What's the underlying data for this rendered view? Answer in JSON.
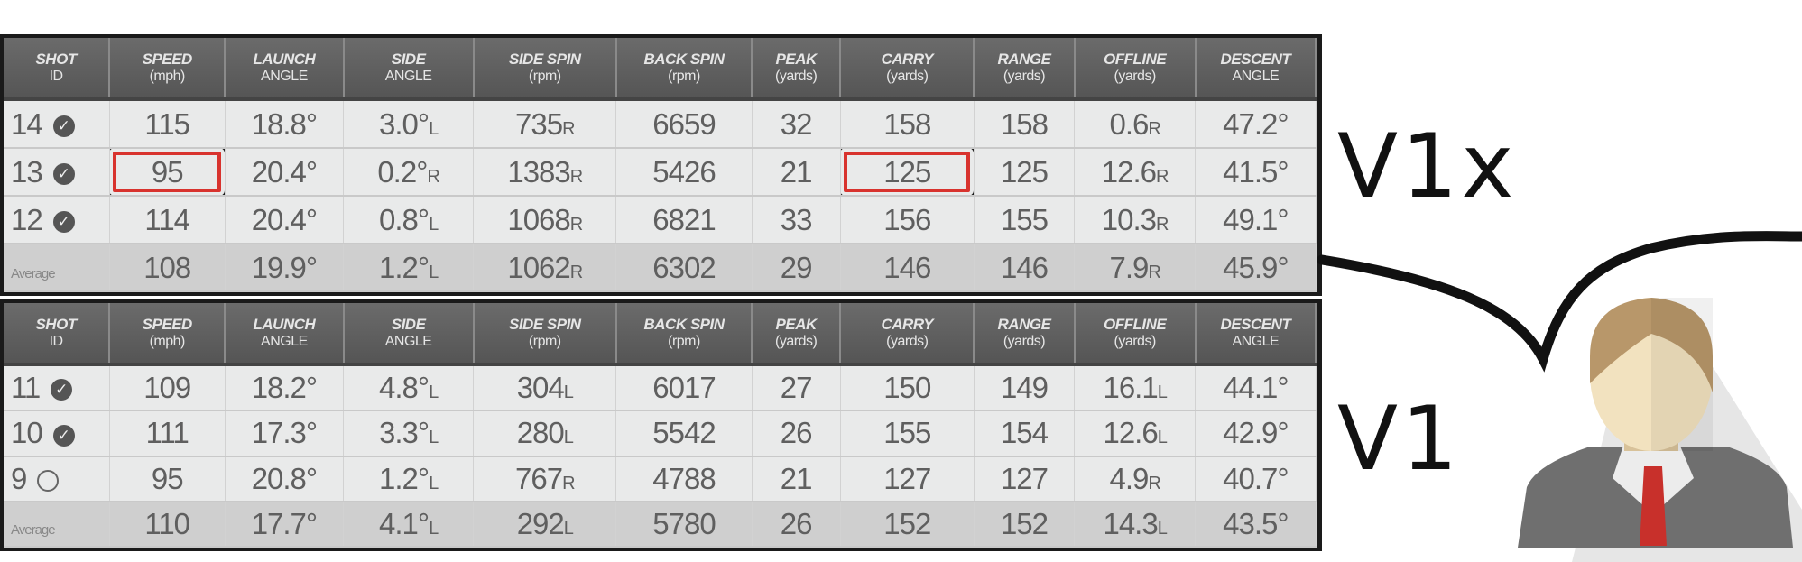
{
  "columns": [
    {
      "name": "SHOT",
      "unit": "ID"
    },
    {
      "name": "SPEED",
      "unit": "(mph)"
    },
    {
      "name": "LAUNCH",
      "unit": "ANGLE"
    },
    {
      "name": "SIDE",
      "unit": "ANGLE"
    },
    {
      "name": "SIDE SPIN",
      "unit": "(rpm)"
    },
    {
      "name": "BACK SPIN",
      "unit": "(rpm)"
    },
    {
      "name": "PEAK",
      "unit": "(yards)"
    },
    {
      "name": "CARRY",
      "unit": "(yards)"
    },
    {
      "name": "RANGE",
      "unit": "(yards)"
    },
    {
      "name": "OFFLINE",
      "unit": "(yards)"
    },
    {
      "name": "DESCENT",
      "unit": "ANGLE"
    }
  ],
  "tables": [
    {
      "label": "V1x",
      "rows": [
        {
          "id": "14",
          "checked": true,
          "cells": [
            "115",
            "18.8°",
            "3.0°|L",
            "735|R",
            "6659",
            "32",
            "158",
            "158",
            "0.6|R",
            "47.2°"
          ]
        },
        {
          "id": "13",
          "checked": true,
          "cells": [
            "95",
            "20.4°",
            "0.2°|R",
            "1383|R",
            "5426",
            "21",
            "125",
            "125",
            "12.6|R",
            "41.5°"
          ],
          "highlight": [
            0,
            6
          ]
        },
        {
          "id": "12",
          "checked": true,
          "cells": [
            "114",
            "20.4°",
            "0.8°|L",
            "1068|R",
            "6821",
            "33",
            "156",
            "155",
            "10.3|R",
            "49.1°"
          ]
        },
        {
          "id": "Average",
          "average": true,
          "cells": [
            "108",
            "19.9°",
            "1.2°|L",
            "1062|R",
            "6302",
            "29",
            "146",
            "146",
            "7.9|R",
            "45.9°"
          ]
        }
      ]
    },
    {
      "label": "V1",
      "rows": [
        {
          "id": "11",
          "checked": true,
          "cells": [
            "109",
            "18.2°",
            "4.8°|L",
            "304|L",
            "6017",
            "27",
            "150",
            "149",
            "16.1|L",
            "44.1°"
          ]
        },
        {
          "id": "10",
          "checked": true,
          "cells": [
            "111",
            "17.3°",
            "3.3°|L",
            "280|L",
            "5542",
            "26",
            "155",
            "154",
            "12.6|L",
            "42.9°"
          ]
        },
        {
          "id": "9",
          "checked": false,
          "cells": [
            "95",
            "20.8°",
            "1.2°|L",
            "767|R",
            "4788",
            "21",
            "127",
            "127",
            "4.9|R",
            "40.7°"
          ]
        },
        {
          "id": "Average",
          "average": true,
          "cells": [
            "110",
            "17.7°",
            "4.1°|L",
            "292|L",
            "5780",
            "26",
            "152",
            "152",
            "14.3|L",
            "43.5°"
          ]
        }
      ]
    }
  ],
  "colors": {
    "highlight": "#d8332e",
    "header": "#5e5e5e",
    "row": "#e9eaea",
    "average_row": "#cfcfcf"
  },
  "icons": {
    "check": "check-circle-icon",
    "unchecked": "empty-circle-icon",
    "person": "businessman-avatar-icon"
  }
}
